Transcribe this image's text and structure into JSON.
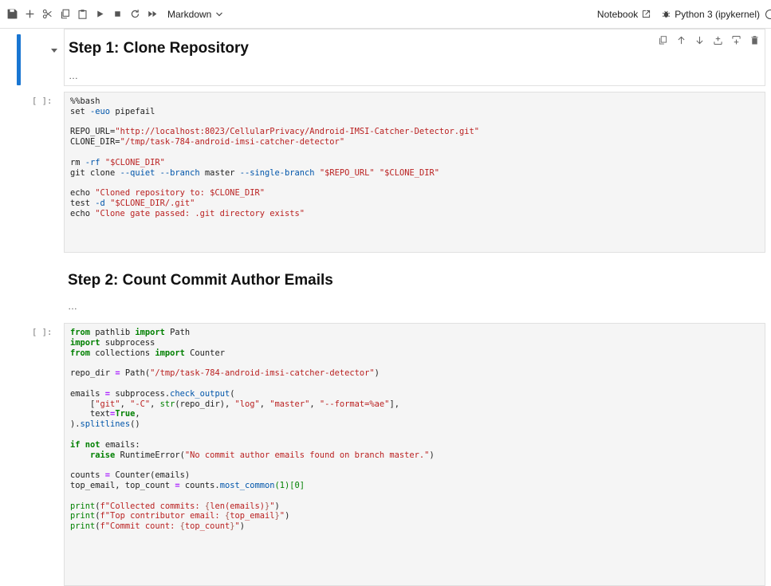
{
  "toolbar": {
    "cell_type": "Markdown",
    "notebook_label": "Notebook",
    "kernel_label": "Python 3 (ipykernel)"
  },
  "cells": {
    "md1": {
      "title": "Step 1: Clone Repository",
      "ellipsis": "…"
    },
    "code1": {
      "prompt": "[ ]:"
    },
    "md2": {
      "title": "Step 2: Count Commit Author Emails",
      "ellipsis": "…"
    },
    "code2": {
      "prompt": "[ ]:"
    }
  },
  "code1_lines": [
    "%%bash",
    "set -euo pipefail",
    "",
    "REPO_URL=\"http://localhost:8023/CellularPrivacy/Android-IMSI-Catcher-Detector.git\"",
    "CLONE_DIR=\"/tmp/task-784-android-imsi-catcher-detector\"",
    "",
    "rm -rf \"$CLONE_DIR\"",
    "git clone --quiet --branch master --single-branch \"$REPO_URL\" \"$CLONE_DIR\"",
    "",
    "echo \"Cloned repository to: $CLONE_DIR\"",
    "test -d \"$CLONE_DIR/.git\"",
    "echo \"Clone gate passed: .git directory exists\""
  ],
  "code2_lines": [
    "from pathlib import Path",
    "import subprocess",
    "from collections import Counter",
    "",
    "repo_dir = Path(\"/tmp/task-784-android-imsi-catcher-detector\")",
    "",
    "emails = subprocess.check_output(",
    "    [\"git\", \"-C\", str(repo_dir), \"log\", \"master\", \"--format=%ae\"],",
    "    text=True,",
    ").splitlines()",
    "",
    "if not emails:",
    "    raise RuntimeError(\"No commit author emails found on branch master.\")",
    "",
    "counts = Counter(emails)",
    "top_email, top_count = counts.most_common(1)[0]",
    "",
    "print(f\"Collected commits: {len(emails)}\")",
    "print(f\"Top contributor email: {top_email}\")",
    "print(f\"Commit count: {top_count}\")"
  ]
}
